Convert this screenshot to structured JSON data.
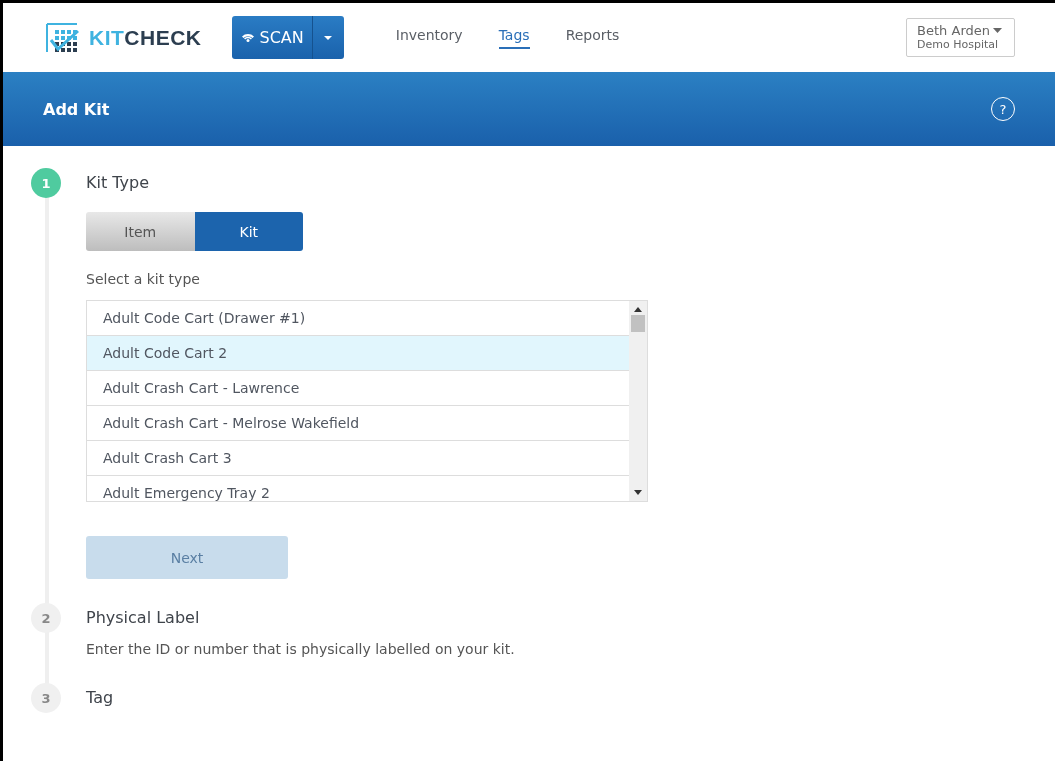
{
  "header": {
    "logo": {
      "prefix": "KIT",
      "suffix": "CHECK"
    },
    "scan_button": "SCAN",
    "nav": [
      {
        "label": "Inventory",
        "selected": false
      },
      {
        "label": "Tags",
        "selected": true
      },
      {
        "label": "Reports",
        "selected": false
      }
    ],
    "user": {
      "name": "Beth Arden",
      "org": "Demo Hospital"
    }
  },
  "title_bar": {
    "title": "Add Kit",
    "help": "?"
  },
  "steps": [
    {
      "number": "1",
      "title": "Kit Type",
      "active": true,
      "toggle": [
        {
          "label": "Item",
          "selected": false
        },
        {
          "label": "Kit",
          "selected": true
        }
      ],
      "list_label": "Select a kit type",
      "list": [
        {
          "label": "Adult Code Cart (Drawer #1)",
          "selected": false
        },
        {
          "label": "Adult Code Cart 2",
          "selected": true
        },
        {
          "label": "Adult Crash Cart - Lawrence",
          "selected": false
        },
        {
          "label": "Adult Crash Cart - Melrose Wakefield",
          "selected": false
        },
        {
          "label": "Adult Crash Cart 3",
          "selected": false
        },
        {
          "label": "Adult Emergency Tray 2",
          "selected": false
        }
      ],
      "next": {
        "label": "Next",
        "disabled": true
      }
    },
    {
      "number": "2",
      "title": "Physical Label",
      "active": false,
      "description": "Enter the ID or number that is physically labelled on your kit."
    },
    {
      "number": "3",
      "title": "Tag",
      "active": false
    }
  ]
}
